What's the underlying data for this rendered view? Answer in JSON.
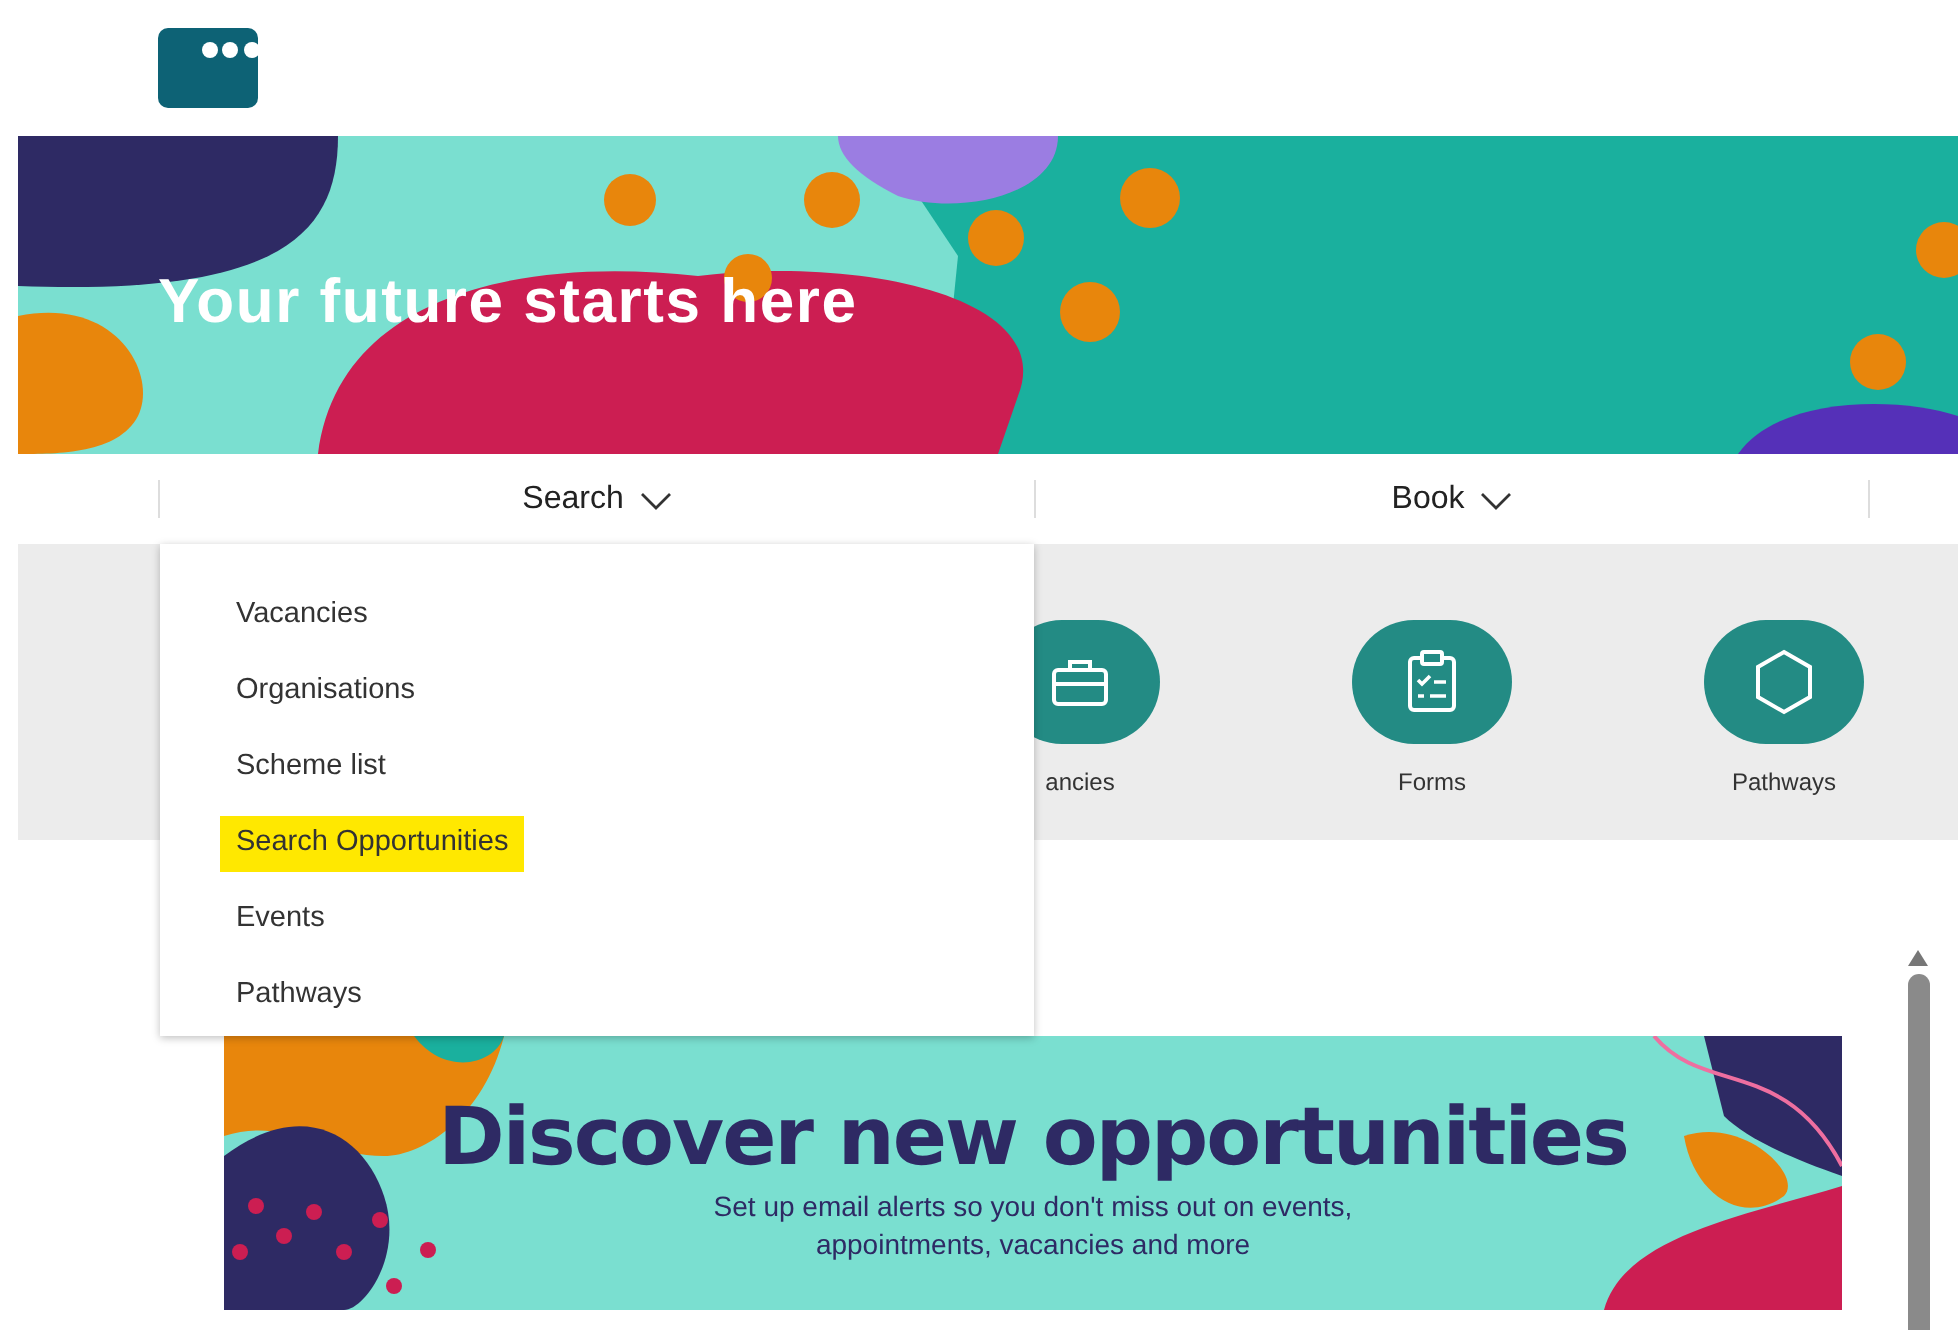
{
  "hero": {
    "title": "Your future starts here"
  },
  "nav": [
    {
      "label": "Search"
    },
    {
      "label": "Book"
    }
  ],
  "search_menu": [
    {
      "label": "Vacancies",
      "highlighted": false
    },
    {
      "label": "Organisations",
      "highlighted": false
    },
    {
      "label": "Scheme list",
      "highlighted": false
    },
    {
      "label": "Search Opportunities",
      "highlighted": true
    },
    {
      "label": "Events",
      "highlighted": false
    },
    {
      "label": "Pathways",
      "highlighted": false
    }
  ],
  "quick_links": [
    {
      "kind": "briefcase",
      "label": "ancies"
    },
    {
      "kind": "clipboard",
      "label": "Forms"
    },
    {
      "kind": "hexagon",
      "label": "Pathways"
    }
  ],
  "banner": {
    "title": "Discover new opportunities",
    "text": "Set up email alerts so you don't miss out on events, appointments, vacancies and more"
  }
}
